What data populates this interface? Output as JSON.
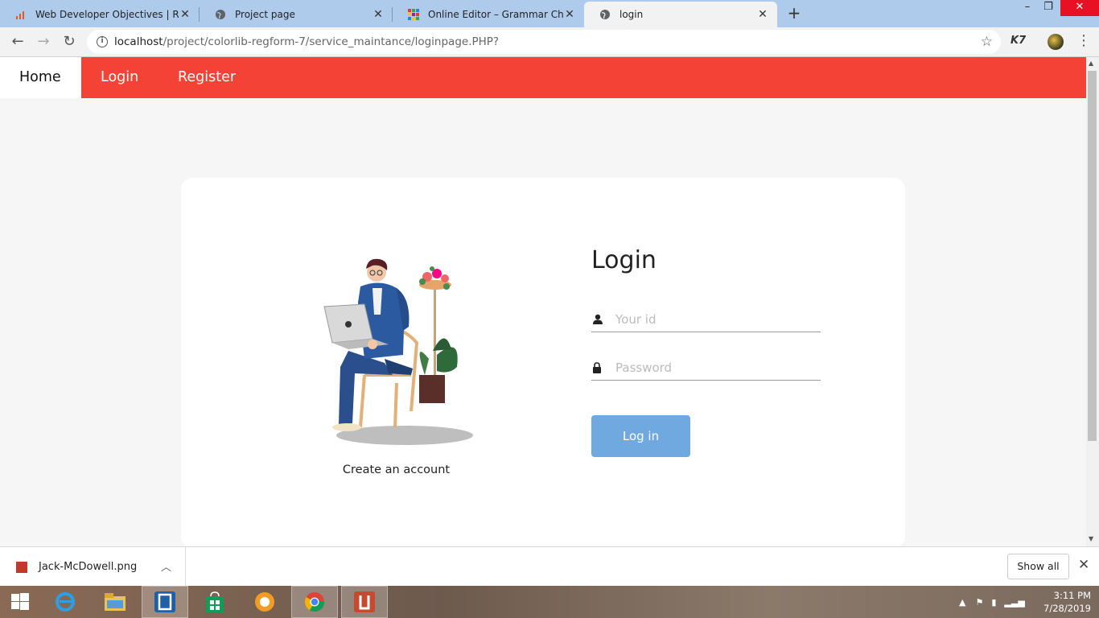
{
  "browser": {
    "tabs": [
      {
        "title": "Web Developer Objectives | Resu",
        "favicon": "chart-icon",
        "active": false
      },
      {
        "title": "Project page",
        "favicon": "globe-icon",
        "active": false
      },
      {
        "title": "Online Editor – Grammar Checke",
        "favicon": "grid-icon",
        "active": false
      },
      {
        "title": "login",
        "favicon": "globe-icon",
        "active": true
      }
    ],
    "address": {
      "host": "localhost",
      "path": "/project/colorlib-regform-7/service_maintance/loginpage.PHP?"
    },
    "extension_label": "K7"
  },
  "page": {
    "nav": {
      "home": "Home",
      "login": "Login",
      "register": "Register"
    },
    "create_account": "Create an account",
    "login_title": "Login",
    "id_placeholder": "Your id",
    "password_placeholder": "Password",
    "login_button": "Log in",
    "accent_color": "#f44336",
    "button_color": "#6fa9e0"
  },
  "downloads": {
    "file_name": "Jack-McDowell.png",
    "show_all": "Show all"
  },
  "taskbar": {
    "time": "3:11 PM",
    "date": "7/28/2019"
  }
}
